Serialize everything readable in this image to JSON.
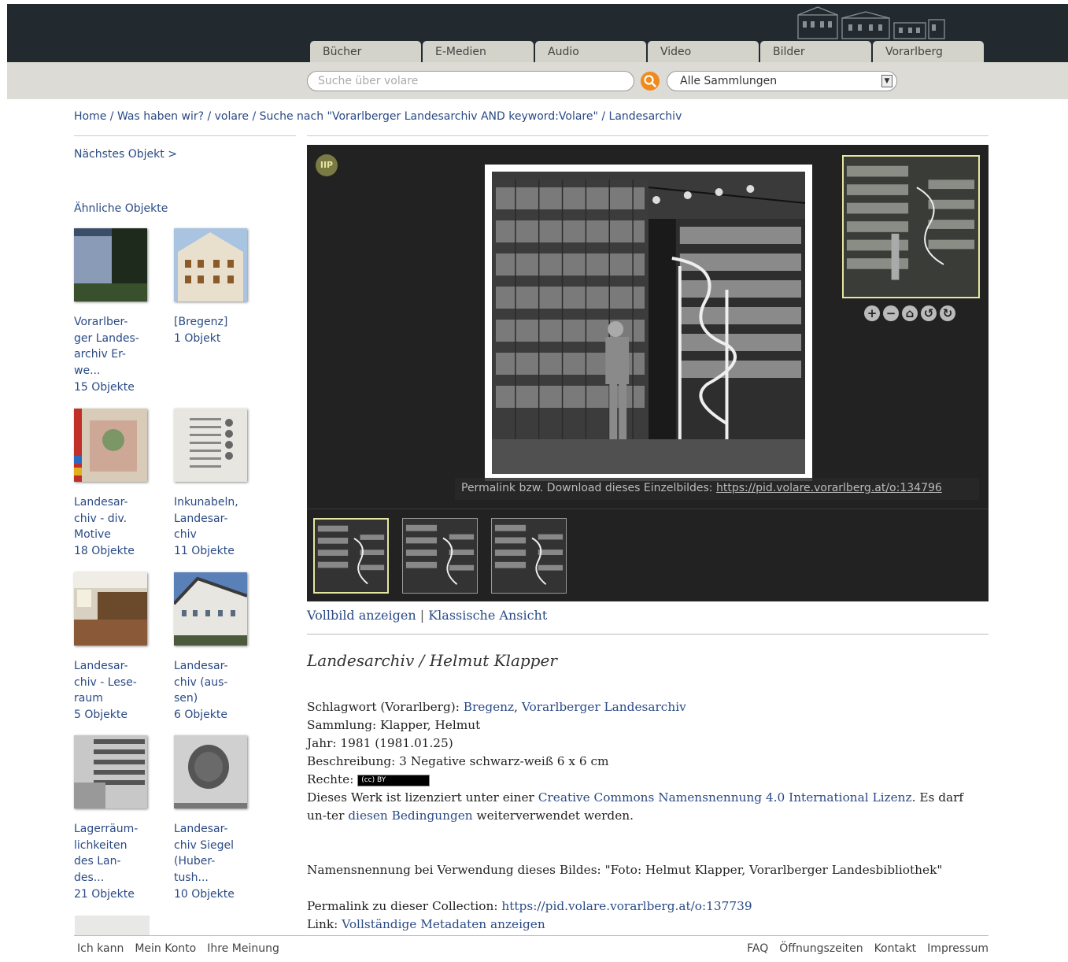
{
  "nav": {
    "tabs": [
      "Bücher",
      "E-Medien",
      "Audio",
      "Video",
      "Bilder",
      "Vorarlberg"
    ]
  },
  "search": {
    "placeholder": "Suche über volare",
    "collection_selected": "Alle Sammlungen"
  },
  "breadcrumb": "Home / Was haben wir? / volare / Suche nach \"Vorarlberger Landesarchiv AND keyword:Volare\" / Landesarchiv",
  "sidebar": {
    "next_object": "Nächstes Objekt >",
    "similar_title": "Ähnliche Objekte",
    "items": [
      {
        "label": "Vorarlber-\nger Lan­des-\narchiv Er-\nwe...",
        "count": "15 Objekte"
      },
      {
        "label": "[Bregenz]",
        "count": "1 Objekt"
      },
      {
        "label": "Landesar-\nchiv - div.\nMotive",
        "count": "18 Objekte"
      },
      {
        "label": "Inkunabeln,\nLandesar-\nchiv",
        "count": "11 Objekte"
      },
      {
        "label": "Landesar-\nchiv - Lese-\nraum",
        "count": "5 Objekte"
      },
      {
        "label": "Landesar-\nchiv (aus-\nsen)",
        "count": "6 Objekte"
      },
      {
        "label": "Lagerräum-\nlichkeiten\ndes Lan-\ndes...",
        "count": "21 Objekte"
      },
      {
        "label": "Landesar-\nchiv Siegel\n(Huber-\ntush...",
        "count": "10 Objekte"
      }
    ]
  },
  "viewer": {
    "logo": "IIP",
    "permalink_label": "Permalink bzw. Download dieses Einzelbildes:",
    "permalink_url": "https://pid.volare.vorarlberg.at/o:134796",
    "icons": [
      "zoom-in-icon",
      "zoom-out-icon",
      "home-icon",
      "rotate-left-icon",
      "rotate-right-icon"
    ]
  },
  "view_links": {
    "fullscreen": "Vollbild anzeigen",
    "separator": "|",
    "classic": "Klassische Ansicht"
  },
  "record": {
    "title": "Landesarchiv / Helmut Klapper",
    "keyword_label": "Schlagwort (Vorarlberg):",
    "keyword_1": "Bregenz",
    "keyword_sep": ",",
    "keyword_2": "Vorarlberger Landesarchiv",
    "collection": "Sammlung: Klapper, Helmut",
    "year": "Jahr: 1981 (1981.01.25)",
    "description": "Beschreibung: 3 Negative schwarz-weiß 6 x 6 cm",
    "rights_label": "Rechte:",
    "rights_badge": "(cc) BY",
    "license_pre": "Dieses Werk ist lizenziert unter einer",
    "license_link": "Creative Commons Namensnennung 4.0 International Lizenz",
    "license_mid": ". Es darf un-ter",
    "conditions_link": "diesen Bedingungen",
    "license_post": "weiterverwendet werden.",
    "attribution": "Namensnennung bei Verwendung dieses Bildes: \"Foto: Helmut Klapper, Vorarlberger Landesbibliothek\"",
    "permalink_label": "Permalink zu dieser Collection:",
    "permalink_url": "https://pid.volare.vorarlberg.at/o:137739",
    "link_label": "Link:",
    "metadata_link": "Vollständige Metadaten anzeigen"
  },
  "footer": {
    "left": [
      "Ich kann",
      "Mein Konto",
      "Ihre Meinung"
    ],
    "right": [
      "FAQ",
      "Öffnungszeiten",
      "Kontakt",
      "Impressum"
    ]
  },
  "colors": {
    "header_dark": "#222a30",
    "tab_bg": "#d4d3ca",
    "link": "#2a4a85",
    "search_button": "#f08a1b",
    "viewer_bg": "#222222",
    "highlight": "#e6e6a0"
  }
}
